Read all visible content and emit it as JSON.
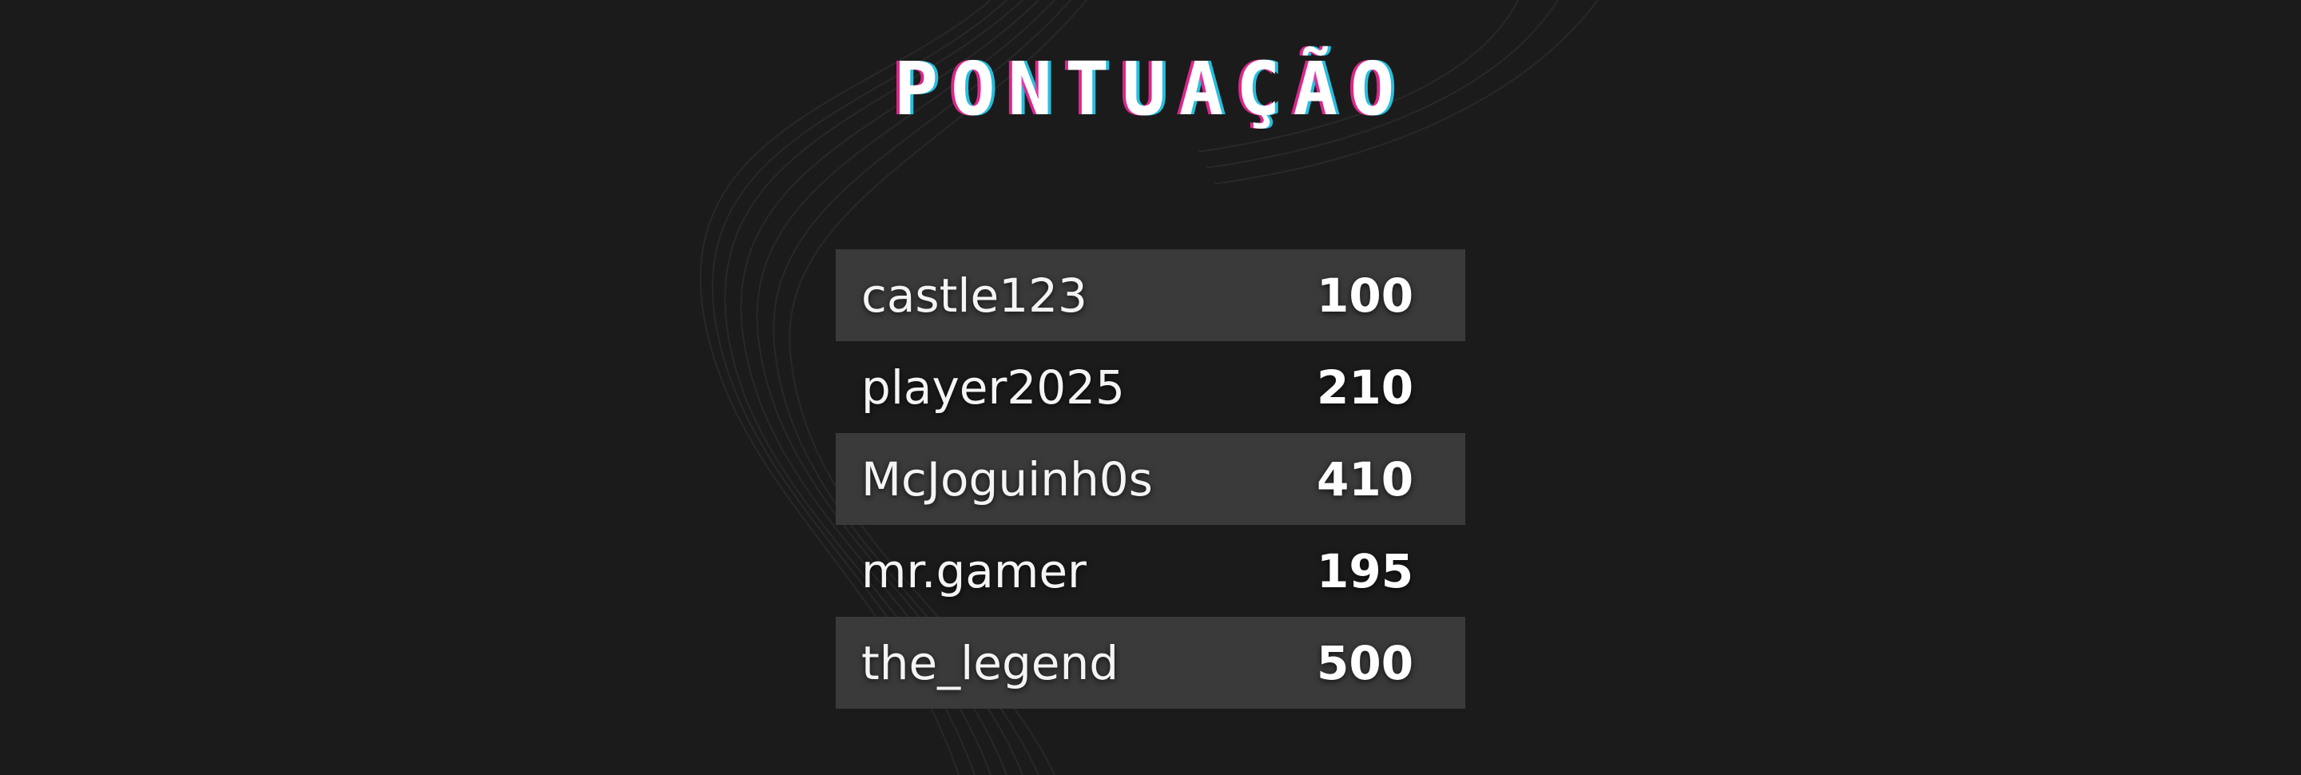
{
  "title": "PONTUAÇÃO",
  "colors": {
    "background": "#1b1b1b",
    "row_highlight": "#3a3a3a",
    "text": "#ffffff"
  },
  "scoreboard": [
    {
      "name": "castle123",
      "score": "100"
    },
    {
      "name": "player2025",
      "score": "210"
    },
    {
      "name": "McJoguinh0s",
      "score": "410"
    },
    {
      "name": "mr.gamer",
      "score": "195"
    },
    {
      "name": "the_legend",
      "score": "500"
    }
  ]
}
